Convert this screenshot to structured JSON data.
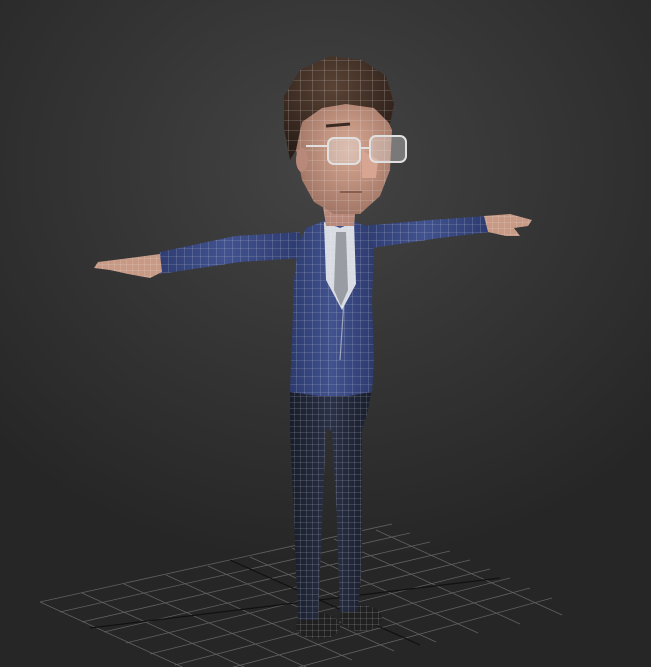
{
  "viewport": {
    "scene": "character-model-t-pose",
    "shading": "shaded-with-wireframe",
    "colors": {
      "background_top": "#444444",
      "background_bottom": "#262626",
      "grid_line": "#7a7a7a",
      "grid_axis": "#111111",
      "wire": "#e6e6e6",
      "suit": "#3a4a86",
      "trousers": "#1f2536",
      "skin": "#c89a86",
      "hair": "#3b2a22",
      "shirt": "#d9dce3",
      "tie": "#9a9ca3",
      "shoes": "#202020",
      "glasses": "#e0e0e0"
    }
  }
}
